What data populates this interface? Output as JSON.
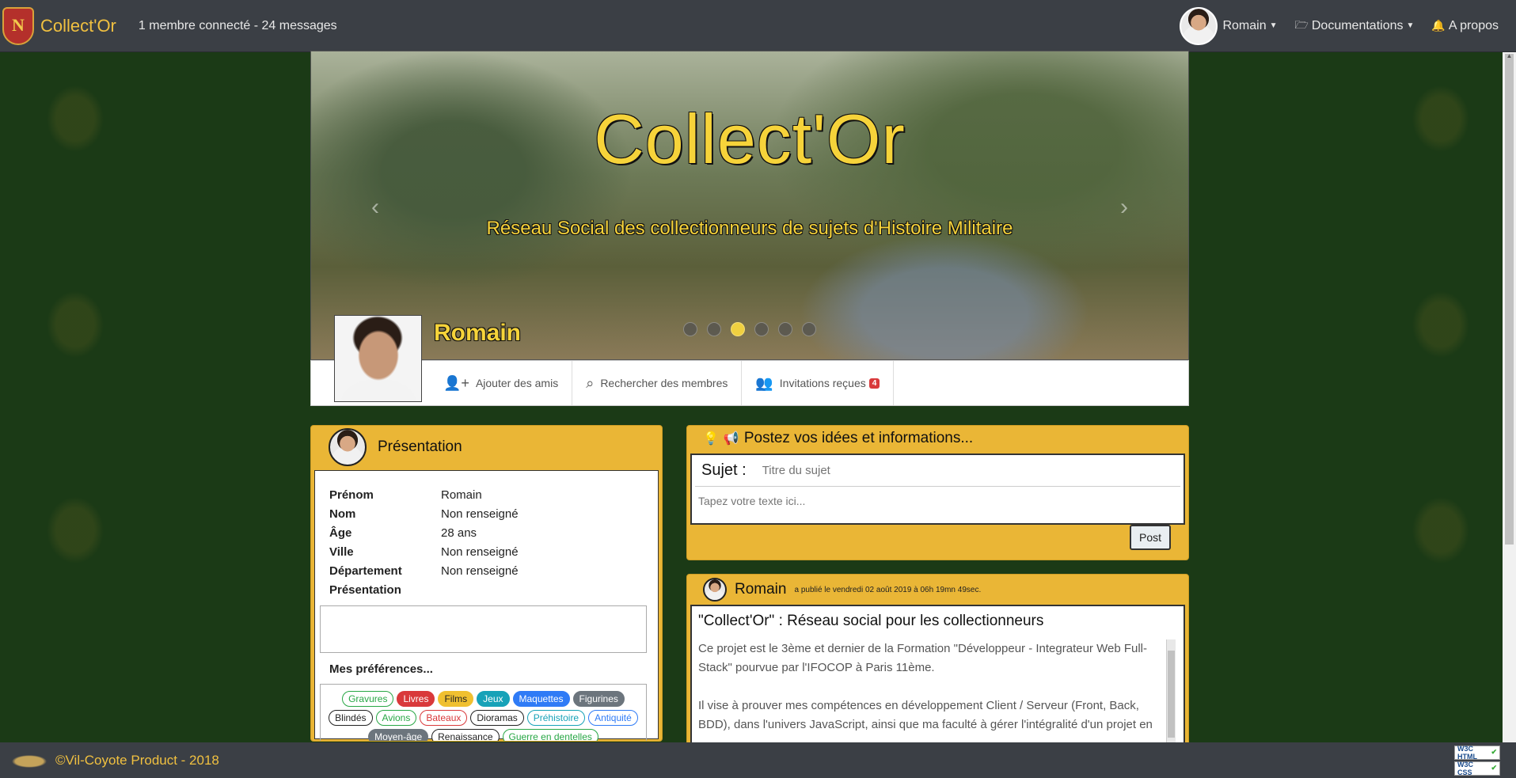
{
  "navbar": {
    "brand": "Collect'Or",
    "stats": "1 membre connecté - 24 messages",
    "user_name": "Romain",
    "docs_label": "Documentations",
    "about_label": "A propos"
  },
  "hero": {
    "title": "Collect'Or",
    "subtitle": "Réseau Social des collectionneurs de sujets d'Histoire Militaire",
    "slide_count": 6,
    "active_slide": 3
  },
  "profile": {
    "name": "Romain",
    "actions": {
      "add_friends": "Ajouter des amis",
      "search_members": "Rechercher des membres",
      "invitations": "Invitations reçues",
      "invitations_count": "4"
    }
  },
  "presentation": {
    "title": "Présentation",
    "fields": [
      {
        "label": "Prénom",
        "value": "Romain"
      },
      {
        "label": "Nom",
        "value": "Non renseigné"
      },
      {
        "label": "Âge",
        "value": "28 ans"
      },
      {
        "label": "Ville",
        "value": "Non renseigné"
      },
      {
        "label": "Département",
        "value": "Non renseigné"
      },
      {
        "label": "Présentation",
        "value": ""
      }
    ],
    "prefs_title": "Mes préférences...",
    "tags": [
      {
        "label": "Gravures",
        "style": "out-green"
      },
      {
        "label": "Livres",
        "style": "red"
      },
      {
        "label": "Films",
        "style": "yellow"
      },
      {
        "label": "Jeux",
        "style": "teal"
      },
      {
        "label": "Maquettes",
        "style": "blue"
      },
      {
        "label": "Figurines",
        "style": "gray"
      },
      {
        "label": "Blindés",
        "style": "out-dark"
      },
      {
        "label": "Avions",
        "style": "out-green"
      },
      {
        "label": "Bateaux",
        "style": "out-red"
      },
      {
        "label": "Dioramas",
        "style": "out-dark"
      },
      {
        "label": "Préhistoire",
        "style": "out-teal"
      },
      {
        "label": "Antiquité",
        "style": "out-blue"
      },
      {
        "label": "Moyen-âge",
        "style": "gray"
      },
      {
        "label": "Renaissance",
        "style": "out-dark"
      },
      {
        "label": "Guerre en dentelles",
        "style": "out-green"
      }
    ]
  },
  "compose": {
    "title": "Postez vos idées et informations...",
    "subject_label": "Sujet :",
    "subject_placeholder": "Titre du sujet",
    "message_placeholder": "Tapez votre texte ici...",
    "post_label": "Post"
  },
  "post": {
    "author": "Romain",
    "meta": "a publié le vendredi 02 août 2019 à 06h 19mn 49sec.",
    "title": "\"Collect'Or\" : Réseau social pour les collectionneurs",
    "paragraph1": "Ce projet est le 3ème et dernier de la Formation \"Développeur - Integrateur Web Full-Stack\" pourvue par l'IFOCOP à Paris 11ème.",
    "paragraph2": "Il vise à prouver mes compétences en développement Client / Serveur (Front, Back, BDD), dans l'univers JavaScript, ainsi que ma faculté à gérer l'intégralité d'un projet en"
  },
  "footer": {
    "credit": "©Vil-Coyote Product - 2018",
    "badge_html": "W3C HTML",
    "badge_css": "W3C CSS"
  },
  "colors": {
    "navbar": "#3b3f45",
    "accent_gold": "#eab636",
    "brand_yellow": "#f0c040",
    "background": "#1b3a16"
  }
}
